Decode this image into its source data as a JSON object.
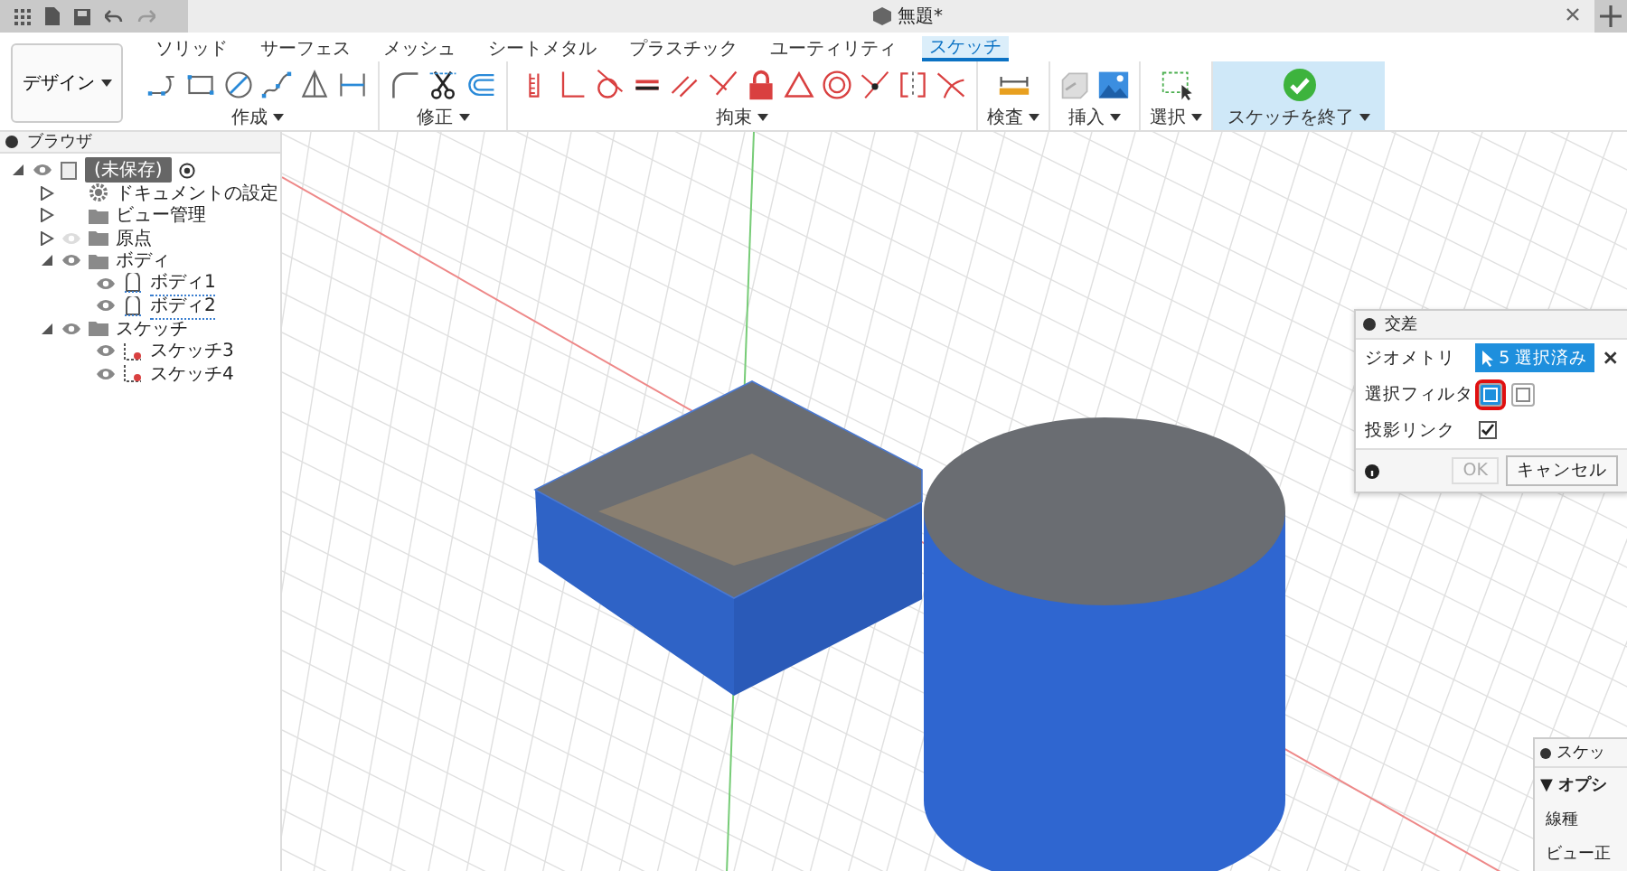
{
  "document_tab": {
    "title": "無題*"
  },
  "workspace": {
    "label": "デザイン"
  },
  "tabs": [
    {
      "label": "ソリッド",
      "selected": false
    },
    {
      "label": "サーフェス",
      "selected": false
    },
    {
      "label": "メッシュ",
      "selected": false
    },
    {
      "label": "シートメタル",
      "selected": false
    },
    {
      "label": "プラスチック",
      "selected": false
    },
    {
      "label": "ユーティリティ",
      "selected": false
    },
    {
      "label": "スケッチ",
      "selected": true
    }
  ],
  "tool_groups": [
    {
      "kind": "create",
      "label": "作成"
    },
    {
      "kind": "modify",
      "label": "修正"
    },
    {
      "kind": "constrain",
      "label": "拘束"
    },
    {
      "kind": "inspect",
      "label": "検査"
    },
    {
      "kind": "insert",
      "label": "挿入"
    },
    {
      "kind": "select",
      "label": "選択"
    },
    {
      "kind": "finish",
      "label": "スケッチを終了"
    }
  ],
  "browser": {
    "title": "ブラウザ",
    "tree": [
      {
        "kind": "root",
        "label": "(未保存)",
        "expanded": true,
        "visible": true,
        "children": [
          {
            "kind": "settings",
            "label": "ドキュメントの設定",
            "expanded": false
          },
          {
            "kind": "folder",
            "label": "ビュー管理",
            "expanded": false
          },
          {
            "kind": "folder",
            "label": "原点",
            "expanded": false,
            "visible": false
          },
          {
            "kind": "folder",
            "label": "ボディ",
            "expanded": true,
            "visible": true,
            "children": [
              {
                "kind": "body",
                "label": "ボディ1",
                "visible": true
              },
              {
                "kind": "body",
                "label": "ボディ2",
                "visible": true
              }
            ]
          },
          {
            "kind": "folder",
            "label": "スケッチ",
            "expanded": true,
            "visible": true,
            "children": [
              {
                "kind": "sketch",
                "label": "スケッチ3",
                "visible": true
              },
              {
                "kind": "sketch",
                "label": "スケッチ4",
                "visible": true
              }
            ]
          }
        ]
      }
    ]
  },
  "dialog": {
    "title": "交差",
    "rows": [
      {
        "kind": "selection",
        "label": "ジオメトリ",
        "value": "5 選択済み"
      },
      {
        "kind": "filter",
        "label": "選択フィルタ",
        "options": [
          {
            "selected": true
          },
          {
            "selected": false
          }
        ]
      },
      {
        "kind": "checkbox",
        "label": "投影リンク",
        "checked": true
      }
    ],
    "buttons": [
      {
        "label": "OK",
        "disabled": true
      },
      {
        "label": "キャンセル",
        "disabled": false
      }
    ]
  },
  "side_panel": {
    "title": "スケッ",
    "section": "▼ オプシ",
    "rows": [
      "線種",
      "ビュー正"
    ]
  }
}
